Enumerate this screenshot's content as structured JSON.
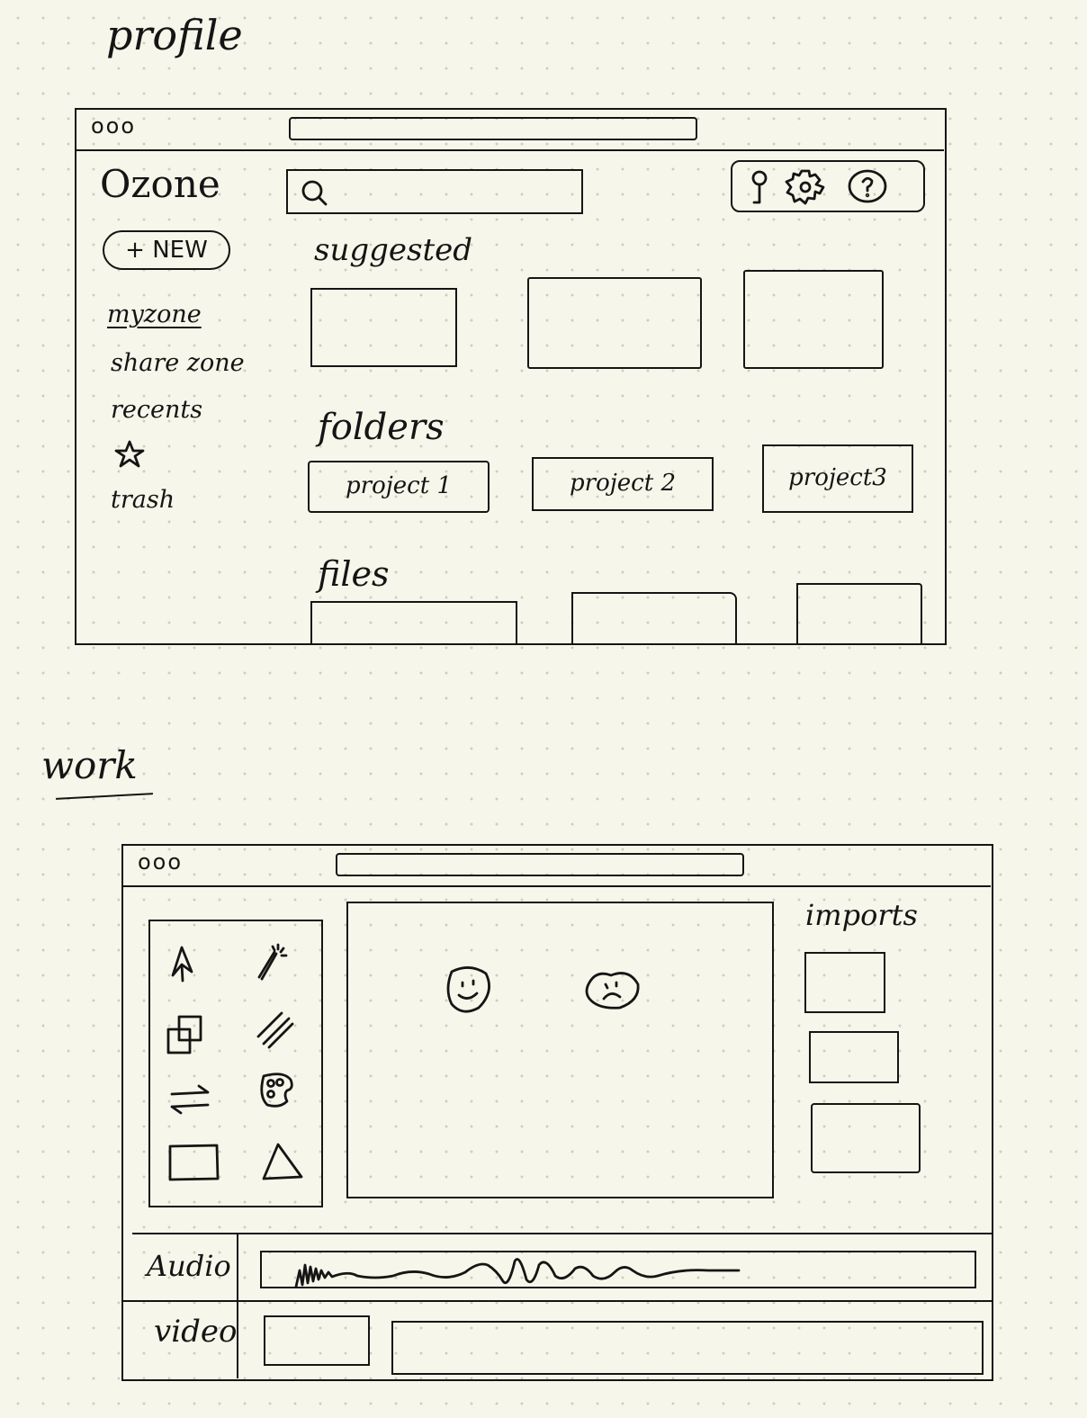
{
  "profile": {
    "heading": "profile",
    "window_controls": "ooo",
    "brand": "Ozone",
    "new_button": "+ NEW",
    "nav": [
      "myzone",
      "share zone",
      "recents",
      "trash"
    ],
    "star_icon": "star-icon",
    "header_icons": [
      "user-icon",
      "gear-icon",
      "help-icon"
    ],
    "search_icon": "search-icon",
    "suggested_label": "suggested",
    "folders_label": "folders",
    "folders": [
      "project 1",
      "project 2",
      "project3"
    ],
    "files_label": "files"
  },
  "work": {
    "heading": "work",
    "window_controls": "ooo",
    "tools": [
      "pen-icon",
      "magic-wand-icon",
      "layers-icon",
      "hatch-icon",
      "swap-arrows-icon",
      "palette-icon",
      "rectangle-icon",
      "triangle-icon"
    ],
    "canvas_faces": [
      "smiley-face-icon",
      "sad-face-icon"
    ],
    "imports_label": "imports",
    "audio_label": "Audio",
    "video_label": "video"
  }
}
